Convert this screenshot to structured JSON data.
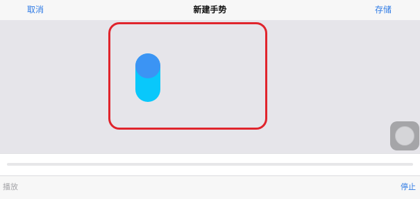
{
  "nav": {
    "cancel_label": "取消",
    "title": "新建手势",
    "save_label": "存储"
  },
  "bottom_bar": {
    "play_label": "播放",
    "stop_label": "停止"
  },
  "colors": {
    "accent": "#2f7be5",
    "touch_point": "#3b94f4",
    "trail": "#09c8fb",
    "highlight": "#e0242c"
  }
}
